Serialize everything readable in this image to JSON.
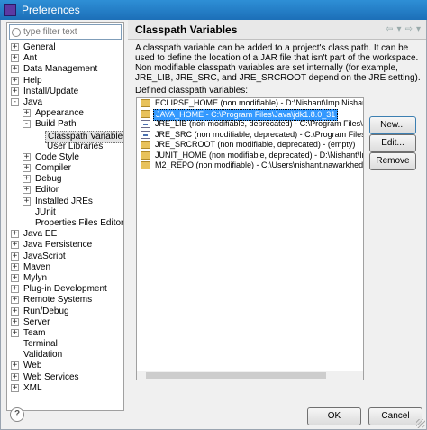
{
  "window": {
    "title": "Preferences"
  },
  "filter": {
    "placeholder": "type filter text"
  },
  "tree": [
    {
      "label": "General",
      "level": 0,
      "expander": "+"
    },
    {
      "label": "Ant",
      "level": 0,
      "expander": "+"
    },
    {
      "label": "Data Management",
      "level": 0,
      "expander": "+"
    },
    {
      "label": "Help",
      "level": 0,
      "expander": "+"
    },
    {
      "label": "Install/Update",
      "level": 0,
      "expander": "+"
    },
    {
      "label": "Java",
      "level": 0,
      "expander": "-"
    },
    {
      "label": "Appearance",
      "level": 1,
      "expander": "+"
    },
    {
      "label": "Build Path",
      "level": 1,
      "expander": "-"
    },
    {
      "label": "Classpath Variables",
      "level": 2,
      "expander": "",
      "selected": true
    },
    {
      "label": "User Libraries",
      "level": 2,
      "expander": ""
    },
    {
      "label": "Code Style",
      "level": 1,
      "expander": "+"
    },
    {
      "label": "Compiler",
      "level": 1,
      "expander": "+"
    },
    {
      "label": "Debug",
      "level": 1,
      "expander": "+"
    },
    {
      "label": "Editor",
      "level": 1,
      "expander": "+"
    },
    {
      "label": "Installed JREs",
      "level": 1,
      "expander": "+"
    },
    {
      "label": "JUnit",
      "level": 1,
      "expander": ""
    },
    {
      "label": "Properties Files Editor",
      "level": 1,
      "expander": ""
    },
    {
      "label": "Java EE",
      "level": 0,
      "expander": "+"
    },
    {
      "label": "Java Persistence",
      "level": 0,
      "expander": "+"
    },
    {
      "label": "JavaScript",
      "level": 0,
      "expander": "+"
    },
    {
      "label": "Maven",
      "level": 0,
      "expander": "+"
    },
    {
      "label": "Mylyn",
      "level": 0,
      "expander": "+"
    },
    {
      "label": "Plug-in Development",
      "level": 0,
      "expander": "+"
    },
    {
      "label": "Remote Systems",
      "level": 0,
      "expander": "+"
    },
    {
      "label": "Run/Debug",
      "level": 0,
      "expander": "+"
    },
    {
      "label": "Server",
      "level": 0,
      "expander": "+"
    },
    {
      "label": "Team",
      "level": 0,
      "expander": "+"
    },
    {
      "label": "Terminal",
      "level": 0,
      "expander": ""
    },
    {
      "label": "Validation",
      "level": 0,
      "expander": ""
    },
    {
      "label": "Web",
      "level": 0,
      "expander": "+"
    },
    {
      "label": "Web Services",
      "level": 0,
      "expander": "+"
    },
    {
      "label": "XML",
      "level": 0,
      "expander": "+"
    }
  ],
  "page": {
    "title": "Classpath Variables",
    "description": "A classpath variable can be added to a project's class path. It can be used to define the location of a JAR file that isn't part of the workspace. Non modifiable classpath variables are set internally (for example, JRE_LIB, JRE_SRC, and JRE_SRCROOT depend on the JRE setting).",
    "defined_label": "Defined classpath variables:"
  },
  "variables": [
    {
      "icon": "folder",
      "text": "ECLIPSE_HOME (non modifiable) - D:\\Nishant\\Imp Nishant\\softw"
    },
    {
      "icon": "folder",
      "text": "JAVA_HOME - C:\\Program Files\\Java\\jdk1.8.0_31",
      "selected": true
    },
    {
      "icon": "jar",
      "text": "JRE_LIB (non modifiable, deprecated) - C:\\Program Files\\Java\\jd"
    },
    {
      "icon": "jar",
      "text": "JRE_SRC (non modifiable, deprecated) - C:\\Program Files\\Java\\jd"
    },
    {
      "icon": "folder",
      "text": "JRE_SRCROOT (non modifiable, deprecated) - (empty)"
    },
    {
      "icon": "folder",
      "text": "JUNIT_HOME (non modifiable, deprecated) - D:\\Nishant\\Imp Nisha"
    },
    {
      "icon": "folder",
      "text": "M2_REPO (non modifiable) - C:\\Users\\nishant.nawarkhede\\.m2\\r"
    }
  ],
  "buttons": {
    "new": "New...",
    "edit": "Edit...",
    "remove": "Remove",
    "ok": "OK",
    "cancel": "Cancel"
  },
  "nav": {
    "back": "⇦",
    "back_menu": "▾",
    "forward": "⇨",
    "forward_menu": "▾"
  },
  "help": {
    "glyph": "?"
  }
}
